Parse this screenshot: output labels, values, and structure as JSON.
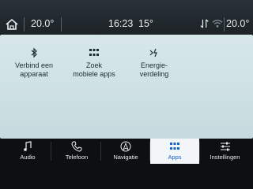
{
  "status": {
    "temp_left": "20.0°",
    "time": "16:23",
    "temp_outside": "15°",
    "temp_right": "20.0°"
  },
  "tiles": [
    {
      "label": "Verbind een\napparaat",
      "icon": "bluetooth-icon"
    },
    {
      "label": "Zoek\nmobiele apps",
      "icon": "grid-icon"
    },
    {
      "label": "Energie-\nverdeling",
      "icon": "power-share-icon"
    }
  ],
  "nav": [
    {
      "label": "Audio",
      "icon": "music-note-icon",
      "active": false
    },
    {
      "label": "Telefoon",
      "icon": "phone-icon",
      "active": false
    },
    {
      "label": "Navigatie",
      "icon": "compass-icon",
      "active": false
    },
    {
      "label": "Apps",
      "icon": "apps-grid-icon",
      "active": true
    },
    {
      "label": "Instellingen",
      "icon": "sliders-icon",
      "active": false
    }
  ],
  "colors": {
    "accent": "#1566c8",
    "panel": "#d7e7ea",
    "statusbar": "#1c2226",
    "navbar": "#0d0f11"
  }
}
